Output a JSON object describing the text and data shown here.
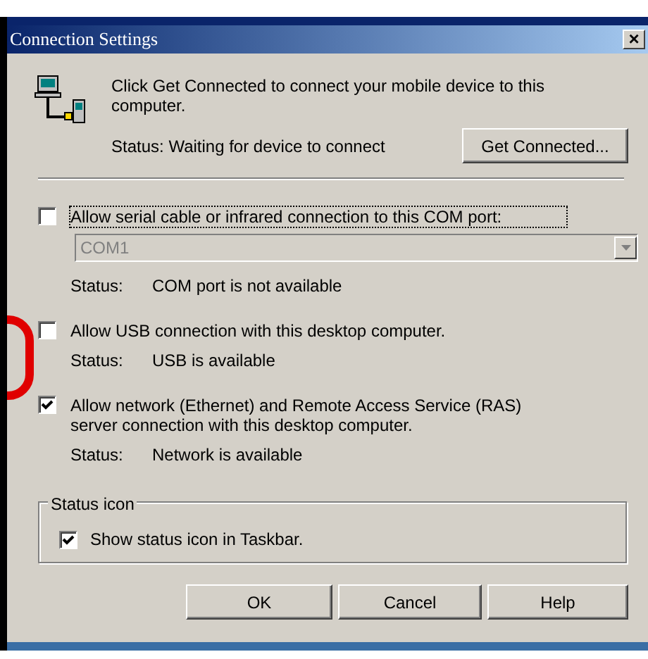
{
  "window": {
    "title": "Connection Settings",
    "close": "×"
  },
  "intro": {
    "text": "Click Get Connected to connect your mobile device to this computer.",
    "status": "Status: Waiting for device to connect",
    "button": "Get Connected..."
  },
  "connections": [
    {
      "kind": "serial",
      "label": "Allow serial cable or infrared connection to this COM port:",
      "checked": false,
      "focused": true,
      "port": {
        "value": "COM1",
        "disabled": true
      },
      "status_label": "Status:",
      "status": "COM port is not available"
    },
    {
      "kind": "plain",
      "label": "Allow USB connection with this desktop computer.",
      "checked": false,
      "focused": false,
      "status_label": "Status:",
      "status": "USB is available"
    },
    {
      "kind": "plain",
      "label": "Allow network (Ethernet) and Remote Access Service (RAS) server connection with this desktop computer.",
      "checked": true,
      "focused": false,
      "status_label": "Status:",
      "status": "Network is available"
    }
  ],
  "status_icon": {
    "legend": "Status icon",
    "label": "Show status icon in Taskbar.",
    "checked": true
  },
  "buttons": [
    "OK",
    "Cancel",
    "Help"
  ]
}
